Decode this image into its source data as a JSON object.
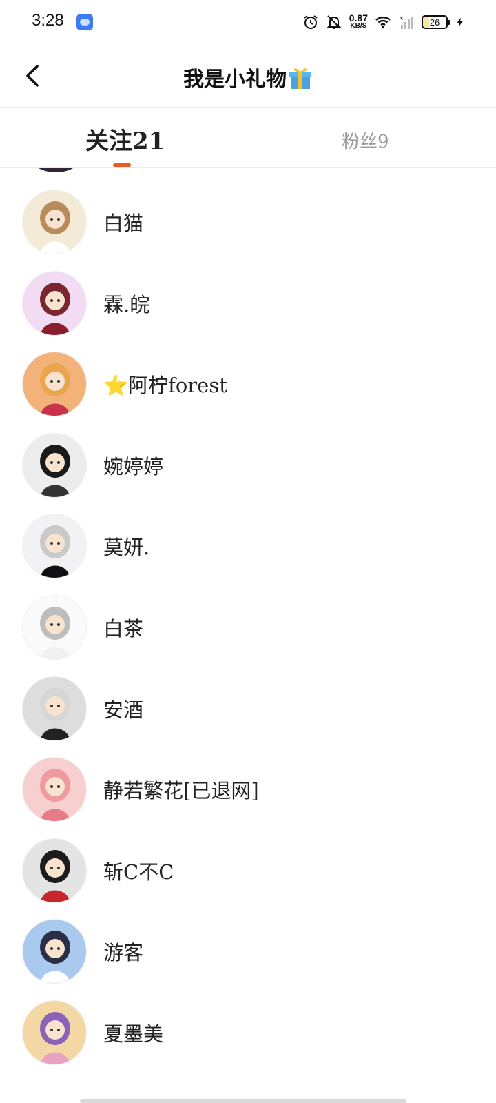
{
  "status_bar": {
    "time": "3:28",
    "net_speed_value": "0.87",
    "net_speed_unit": "KB/S",
    "battery": "26",
    "icons": [
      "app-icon",
      "alarm-icon",
      "mute-bell-icon",
      "wifi-icon",
      "signal-icon",
      "battery-icon",
      "charging-icon"
    ]
  },
  "header": {
    "title": "我是小礼物",
    "back_icon": "chevron-left-icon",
    "title_emoji": "gift-icon"
  },
  "tabs": [
    {
      "label": "关注21",
      "active": true
    },
    {
      "label": "粉丝9",
      "active": false
    }
  ],
  "colors": {
    "accent": "#ee5a24",
    "inactive_tab": "#9a9a9a",
    "star": "#f4b400"
  },
  "list": {
    "items": [
      {
        "name": "白猫",
        "avatar_bg": "#f4ead8",
        "avatar_hair": "#b98b5a",
        "avatar_body": "#ffffff"
      },
      {
        "name": "霖.皖",
        "avatar_bg": "#f1dcf4",
        "avatar_hair": "#7a2530",
        "avatar_body": "#8b1e2c"
      },
      {
        "name": "阿柠forest",
        "prefix_icon": "star-icon",
        "prefix": "⭐",
        "avatar_bg": "#f2b27a",
        "avatar_hair": "#e9a64c",
        "avatar_body": "#c8324a"
      },
      {
        "name": "婉婷婷",
        "avatar_bg": "#ececec",
        "avatar_hair": "#1a1a1a",
        "avatar_body": "#333333"
      },
      {
        "name": "莫妍.",
        "avatar_bg": "#f2f2f4",
        "avatar_hair": "#c9c9c9",
        "avatar_body": "#111111"
      },
      {
        "name": "白茶",
        "avatar_bg": "#fafafa",
        "avatar_hair": "#bdbdbd",
        "avatar_body": "#f0f0f0"
      },
      {
        "name": "安酒",
        "avatar_bg": "#dddddd",
        "avatar_hair": "#d6d6d6",
        "avatar_body": "#222222"
      },
      {
        "name": "静若繁花[已退网]",
        "avatar_bg": "#f7cfcf",
        "avatar_hair": "#f09aa0",
        "avatar_body": "#e77b88"
      },
      {
        "name": "斩C不C",
        "avatar_bg": "#e4e4e4",
        "avatar_hair": "#1c1c1c",
        "avatar_body": "#c6262c"
      },
      {
        "name": "游客",
        "avatar_bg": "#a9c9ee",
        "avatar_hair": "#2a2f45",
        "avatar_body": "#ffffff"
      },
      {
        "name": "夏墨美",
        "avatar_bg": "#f3d7a4",
        "avatar_hair": "#8a62b8",
        "avatar_body": "#e8a3c4"
      }
    ]
  }
}
